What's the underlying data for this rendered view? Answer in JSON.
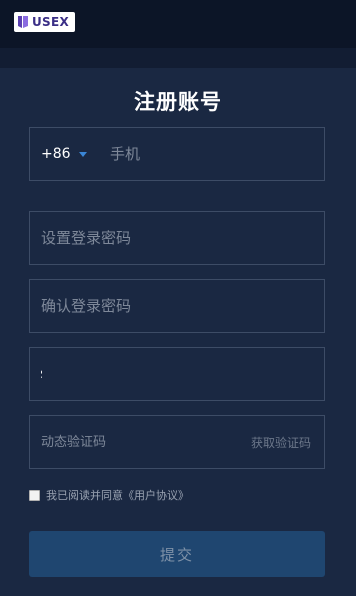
{
  "header": {
    "logo_text": "USEX"
  },
  "form": {
    "title": "注册账号",
    "country_code": "+86",
    "phone_placeholder": "手机",
    "password_placeholder": "设置登录密码",
    "confirm_placeholder": "确认登录密码",
    "captcha_value": "$",
    "sms_placeholder": "动态验证码",
    "get_code_label": "获取验证码",
    "agreement_text": "我已阅读并同意《用户协议》",
    "submit_label": "提交"
  },
  "icons": {
    "logo": "usex-logo-icon",
    "country_dropdown": "caret-down-icon",
    "checkbox": "checkbox-icon"
  },
  "colors": {
    "background": "#1a2842",
    "header": "#0c1527",
    "field_border": "#3d4c66",
    "accent": "#3a86d6",
    "submit_bg": "#1f4670"
  }
}
